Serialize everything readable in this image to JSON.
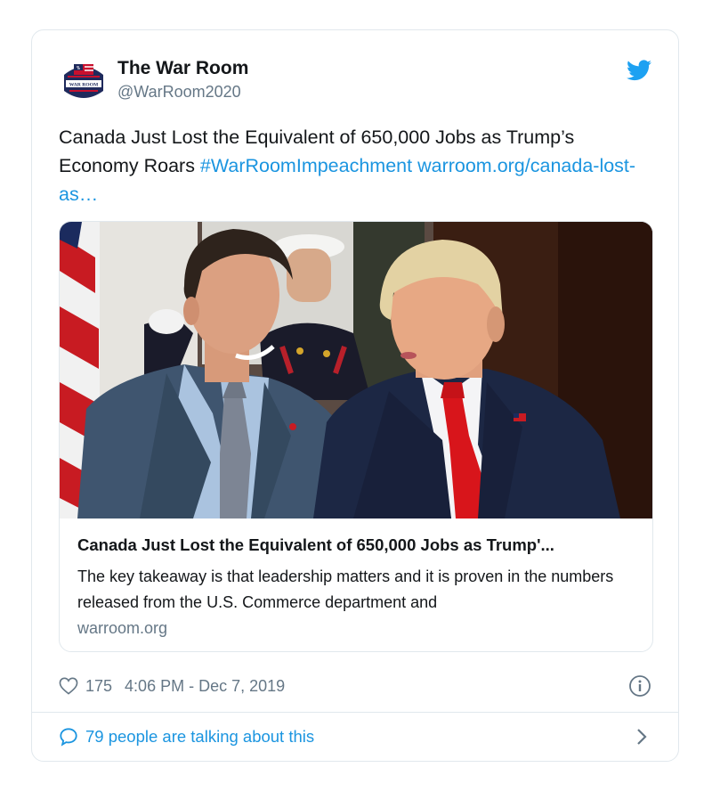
{
  "author": {
    "name": "The War Room",
    "handle": "@WarRoom2020",
    "avatar_text": "WAR ROOM",
    "avatar_icon": "war-room-logo-icon"
  },
  "tweet": {
    "text": "Canada Just Lost the Equivalent of 650,000 Jobs as Trump’s Economy Roars ",
    "hashtag": "#WarRoomImpeachment",
    "link": "warroom.org/canada-lost-as…"
  },
  "link_card": {
    "image_description": "photo",
    "title": "Canada Just Lost the Equivalent of 650,000 Jobs as Trump'...",
    "description": "The key takeaway is that leadership matters and it is proven in the numbers released from the U.S. Commerce department and",
    "domain": "warroom.org"
  },
  "meta": {
    "likes": "175",
    "timestamp": "4:06 PM - Dec 7, 2019"
  },
  "footer": {
    "talking": "79 people are talking about this"
  },
  "colors": {
    "link": "#1b95e0",
    "secondary_text": "#657786",
    "border": "#e1e8ed",
    "tie_red": "#d8151b"
  }
}
